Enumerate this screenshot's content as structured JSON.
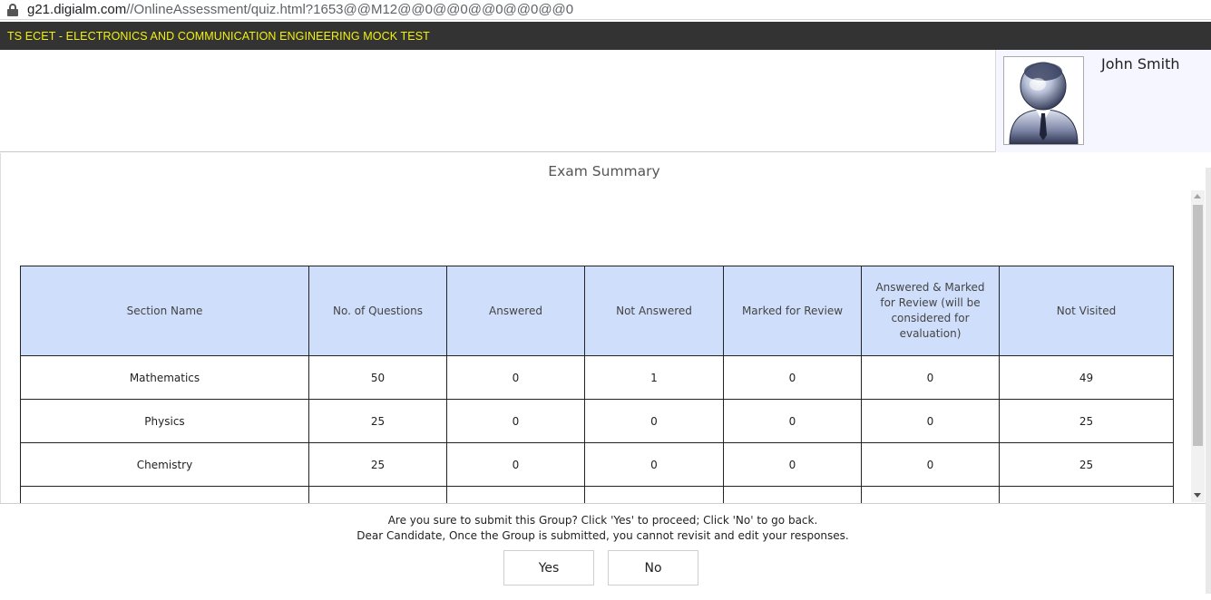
{
  "browser": {
    "url_host": "g21.digialm.com",
    "url_path": "//OnlineAssessment/quiz.html?1653@@M12@@0@@0@@0@@0@@0"
  },
  "app": {
    "title": "TS ECET - ELECTRONICS AND COMMUNICATION ENGINEERING MOCK TEST"
  },
  "user": {
    "name": "John Smith",
    "avatar_icon": "user-avatar-icon"
  },
  "summary": {
    "title": "Exam Summary",
    "columns": [
      "Section Name",
      "No. of Questions",
      "Answered",
      "Not Answered",
      "Marked for Review",
      "Answered & Marked for Review (will be considered for evaluation)",
      "Not Visited"
    ],
    "rows": [
      [
        "Mathematics",
        "50",
        "0",
        "1",
        "0",
        "0",
        "49"
      ],
      [
        "Physics",
        "25",
        "0",
        "0",
        "0",
        "0",
        "25"
      ],
      [
        "Chemistry",
        "25",
        "0",
        "0",
        "0",
        "0",
        "25"
      ]
    ]
  },
  "footer": {
    "confirm_text": "Are you sure to submit this Group? Click 'Yes' to proceed; Click 'No' to go back.",
    "warning_text": "Dear Candidate, Once the Group is submitted, you cannot revisit and edit your responses.",
    "yes_label": "Yes",
    "no_label": "No"
  },
  "colors": {
    "title_bar_bg": "#333333",
    "title_text": "#f2f20a",
    "table_header_bg": "#cfdefa",
    "user_panel_bg": "#f5f6ff"
  }
}
